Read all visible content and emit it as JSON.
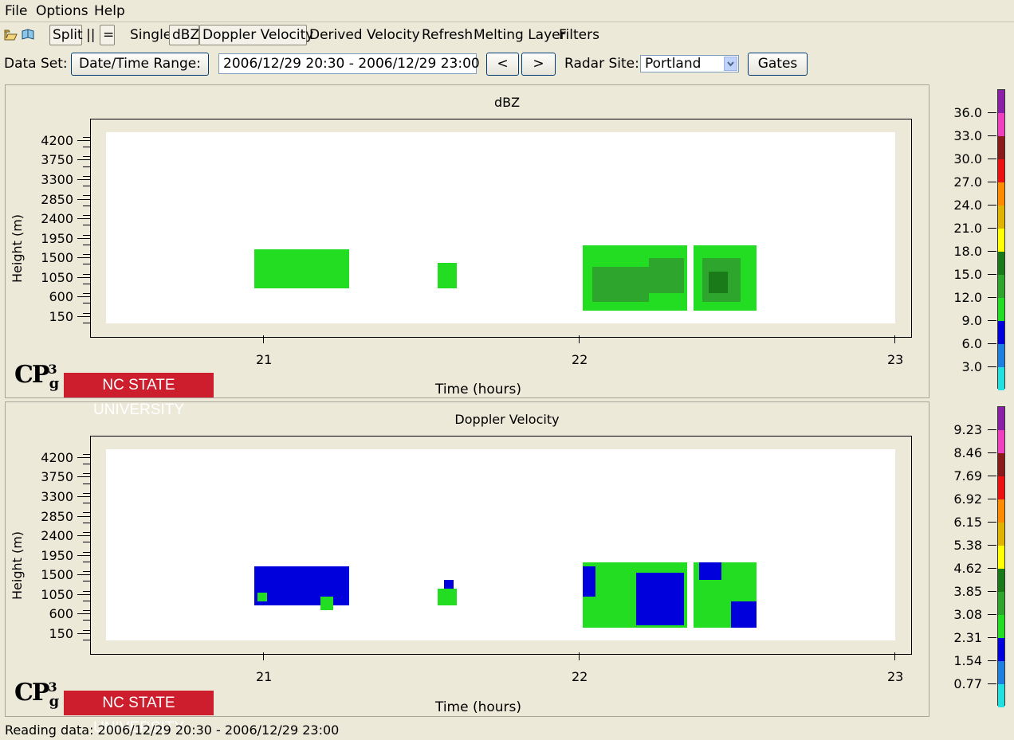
{
  "menu": [
    "File",
    "Options",
    "Help"
  ],
  "toolbar": {
    "split": "Split",
    "parallel": "||",
    "equal": "=",
    "single": "Single",
    "dbz": "dBZ",
    "doppler": "Doppler Velocity",
    "derived": "Derived Velocity",
    "refresh": "Refresh",
    "melting": "Melting Layer",
    "filters": "Filters",
    "icons": [
      "open-folder-icon",
      "open-book-icon"
    ]
  },
  "dataset": {
    "label": "Data Set:",
    "date_range_button": "Date/Time Range:",
    "range_value": "2006/12/29 20:30 - 2006/12/29 23:00",
    "prev": "<",
    "next": ">",
    "radar_site_label": "Radar Site:",
    "radar_site_value": "Portland",
    "gates": "Gates"
  },
  "logos": {
    "cp": "CP",
    "cp_sup": "3",
    "cp_sub": "g",
    "ncsu": "NC STATE UNIVERSITY"
  },
  "status": "Reading data: 2006/12/29 20:30 - 2006/12/29 23:00",
  "chart_data": [
    {
      "type": "heatmap",
      "title": "dBZ",
      "xlabel": "Time (hours)",
      "ylabel": "Height (m)",
      "xlim": [
        20.5,
        23.0
      ],
      "ylim": [
        0,
        4400
      ],
      "x_ticks": [
        "21",
        "22",
        "23"
      ],
      "y_ticks": [
        "4200",
        "3750",
        "3300",
        "2850",
        "2400",
        "1950",
        "1500",
        "1050",
        "600",
        "150"
      ],
      "colorbar": {
        "labels": [
          "36.0",
          "33.0",
          "30.0",
          "27.0",
          "24.0",
          "21.0",
          "18.0",
          "15.0",
          "12.0",
          "9.0",
          "6.0",
          "3.0"
        ],
        "colors": [
          "#8b1fa8",
          "#ee3fbf",
          "#8b1a1a",
          "#ee1111",
          "#ff8c00",
          "#e0b400",
          "#ffff00",
          "#1a7a1a",
          "#2ea62e",
          "#22dd22",
          "#0000dd",
          "#1e7fe0",
          "#22e0e0"
        ]
      },
      "echoes": [
        {
          "t0": 20.97,
          "t1": 21.27,
          "h0": 800,
          "h1": 1700,
          "color": "#22dd22"
        },
        {
          "t0": 21.55,
          "t1": 21.61,
          "h0": 800,
          "h1": 1400,
          "color": "#22dd22"
        },
        {
          "t0": 22.01,
          "t1": 22.34,
          "h0": 300,
          "h1": 1800,
          "color": "#22dd22"
        },
        {
          "t0": 22.04,
          "t1": 22.22,
          "h0": 500,
          "h1": 1300,
          "color": "#2ea62e"
        },
        {
          "t0": 22.22,
          "t1": 22.33,
          "h0": 700,
          "h1": 1500,
          "color": "#2ea62e"
        },
        {
          "t0": 22.36,
          "t1": 22.56,
          "h0": 300,
          "h1": 1800,
          "color": "#22dd22"
        },
        {
          "t0": 22.39,
          "t1": 22.51,
          "h0": 500,
          "h1": 1500,
          "color": "#2ea62e"
        },
        {
          "t0": 22.41,
          "t1": 22.47,
          "h0": 700,
          "h1": 1200,
          "color": "#1a7a1a"
        }
      ]
    },
    {
      "type": "heatmap",
      "title": "Doppler Velocity",
      "xlabel": "Time (hours)",
      "ylabel": "Height (m)",
      "xlim": [
        20.5,
        23.0
      ],
      "ylim": [
        0,
        4400
      ],
      "x_ticks": [
        "21",
        "22",
        "23"
      ],
      "y_ticks": [
        "4200",
        "3750",
        "3300",
        "2850",
        "2400",
        "1950",
        "1500",
        "1050",
        "600",
        "150"
      ],
      "colorbar": {
        "labels": [
          "9.23",
          "8.46",
          "7.69",
          "6.92",
          "6.15",
          "5.38",
          "4.62",
          "3.85",
          "3.08",
          "2.31",
          "1.54",
          "0.77"
        ],
        "colors": [
          "#8b1fa8",
          "#ee3fbf",
          "#8b1a1a",
          "#ee1111",
          "#ff8c00",
          "#e0b400",
          "#ffff00",
          "#1a7a1a",
          "#2ea62e",
          "#22dd22",
          "#0000dd",
          "#1e7fe0",
          "#22e0e0"
        ]
      },
      "echoes": [
        {
          "t0": 20.97,
          "t1": 21.27,
          "h0": 800,
          "h1": 1700,
          "color": "#0000dd"
        },
        {
          "t0": 20.98,
          "t1": 21.01,
          "h0": 900,
          "h1": 1100,
          "color": "#22dd22"
        },
        {
          "t0": 21.18,
          "t1": 21.22,
          "h0": 700,
          "h1": 1000,
          "color": "#22dd22"
        },
        {
          "t0": 21.55,
          "t1": 21.61,
          "h0": 800,
          "h1": 1200,
          "color": "#22dd22"
        },
        {
          "t0": 21.57,
          "t1": 21.6,
          "h0": 1200,
          "h1": 1400,
          "color": "#0000dd"
        },
        {
          "t0": 22.01,
          "t1": 22.34,
          "h0": 300,
          "h1": 1800,
          "color": "#22dd22"
        },
        {
          "t0": 22.01,
          "t1": 22.05,
          "h0": 1000,
          "h1": 1700,
          "color": "#0000dd"
        },
        {
          "t0": 22.18,
          "t1": 22.33,
          "h0": 350,
          "h1": 1550,
          "color": "#0000dd"
        },
        {
          "t0": 22.36,
          "t1": 22.56,
          "h0": 300,
          "h1": 1800,
          "color": "#22dd22"
        },
        {
          "t0": 22.38,
          "t1": 22.45,
          "h0": 1400,
          "h1": 1800,
          "color": "#0000dd"
        },
        {
          "t0": 22.48,
          "t1": 22.56,
          "h0": 300,
          "h1": 900,
          "color": "#0000dd"
        }
      ]
    }
  ]
}
